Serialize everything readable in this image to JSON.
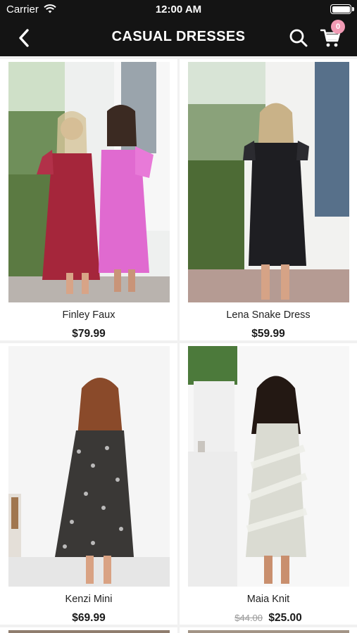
{
  "status_bar": {
    "carrier": "Carrier",
    "time": "12:00 AM"
  },
  "nav": {
    "title": "CASUAL DRESSES",
    "cart_count": "0"
  },
  "products": [
    {
      "name": "Finley Faux",
      "price": "$79.99",
      "old_price": ""
    },
    {
      "name": "Lena Snake Dress",
      "price": "$59.99",
      "old_price": ""
    },
    {
      "name": "Kenzi Mini",
      "price": "$69.99",
      "old_price": ""
    },
    {
      "name": "Maia Knit",
      "price": "$25.00",
      "old_price": "$44.00"
    }
  ],
  "colors": {
    "header_bg": "#141414",
    "badge": "#f19ab4",
    "grid_bg": "#f1f1f1"
  }
}
